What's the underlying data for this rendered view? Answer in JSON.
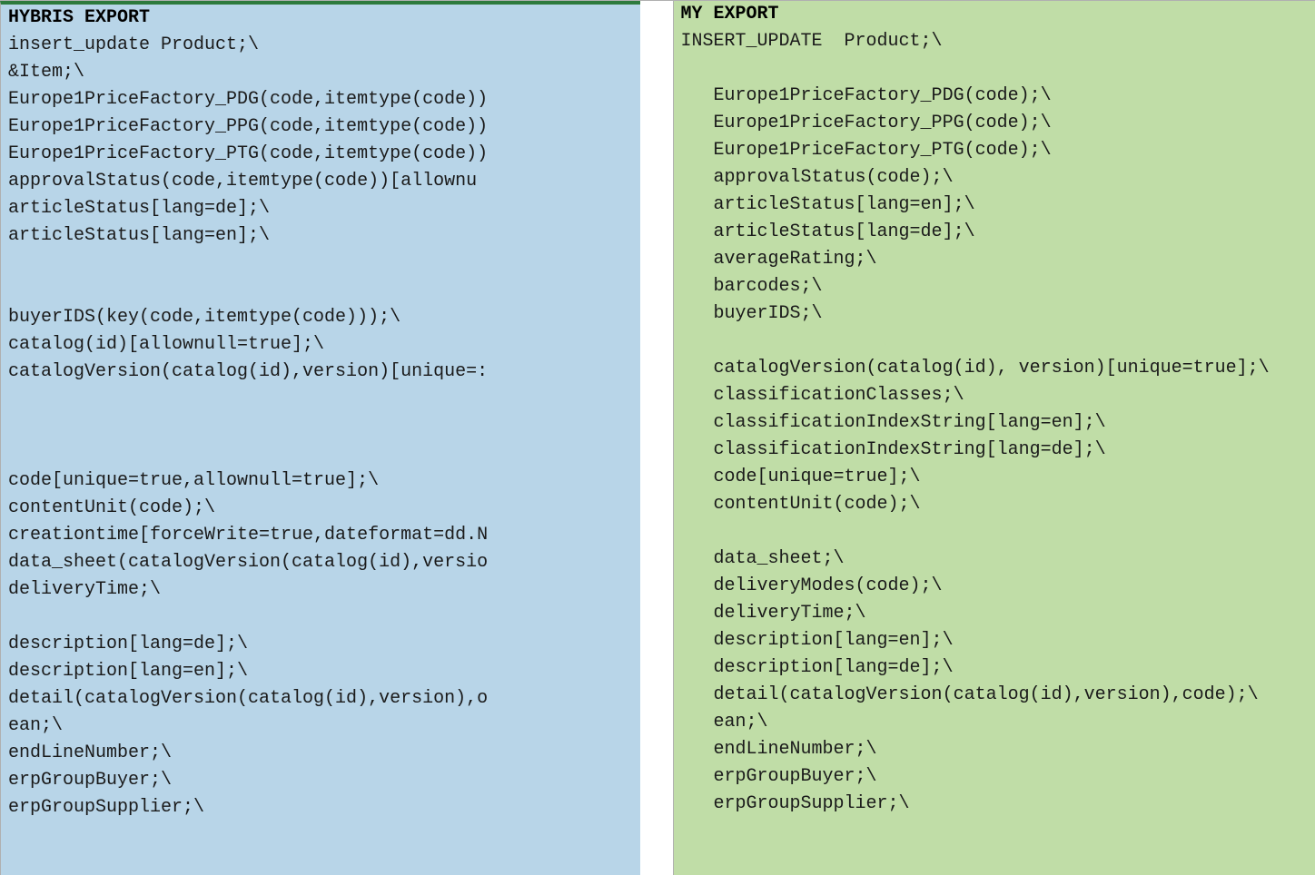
{
  "left": {
    "header": "HYBRIS EXPORT",
    "lines": [
      "insert_update Product;\\",
      "&Item;\\",
      "Europe1PriceFactory_PDG(code,itemtype(code))",
      "Europe1PriceFactory_PPG(code,itemtype(code))",
      "Europe1PriceFactory_PTG(code,itemtype(code))",
      "approvalStatus(code,itemtype(code))[allownu",
      "articleStatus[lang=de];\\",
      "articleStatus[lang=en];\\",
      "",
      "",
      "buyerIDS(key(code,itemtype(code)));\\",
      "catalog(id)[allownull=true];\\",
      "catalogVersion(catalog(id),version)[unique=:",
      "",
      "",
      "",
      "code[unique=true,allownull=true];\\",
      "contentUnit(code);\\",
      "creationtime[forceWrite=true,dateformat=dd.N",
      "data_sheet(catalogVersion(catalog(id),versio",
      "deliveryTime;\\",
      "",
      "description[lang=de];\\",
      "description[lang=en];\\",
      "detail(catalogVersion(catalog(id),version),o",
      "ean;\\",
      "endLineNumber;\\",
      "erpGroupBuyer;\\",
      "erpGroupSupplier;\\"
    ]
  },
  "right": {
    "header": "MY EXPORT",
    "lines": [
      "INSERT_UPDATE  Product;\\",
      "",
      "   Europe1PriceFactory_PDG(code);\\",
      "   Europe1PriceFactory_PPG(code);\\",
      "   Europe1PriceFactory_PTG(code);\\",
      "   approvalStatus(code);\\",
      "   articleStatus[lang=en];\\",
      "   articleStatus[lang=de];\\",
      "   averageRating;\\",
      "   barcodes;\\",
      "   buyerIDS;\\",
      "",
      "   catalogVersion(catalog(id), version)[unique=true];\\",
      "   classificationClasses;\\",
      "   classificationIndexString[lang=en];\\",
      "   classificationIndexString[lang=de];\\",
      "   code[unique=true];\\",
      "   contentUnit(code);\\",
      "",
      "   data_sheet;\\",
      "   deliveryModes(code);\\",
      "   deliveryTime;\\",
      "   description[lang=en];\\",
      "   description[lang=de];\\",
      "   detail(catalogVersion(catalog(id),version),code);\\",
      "   ean;\\",
      "   endLineNumber;\\",
      "   erpGroupBuyer;\\",
      "   erpGroupSupplier;\\"
    ]
  }
}
